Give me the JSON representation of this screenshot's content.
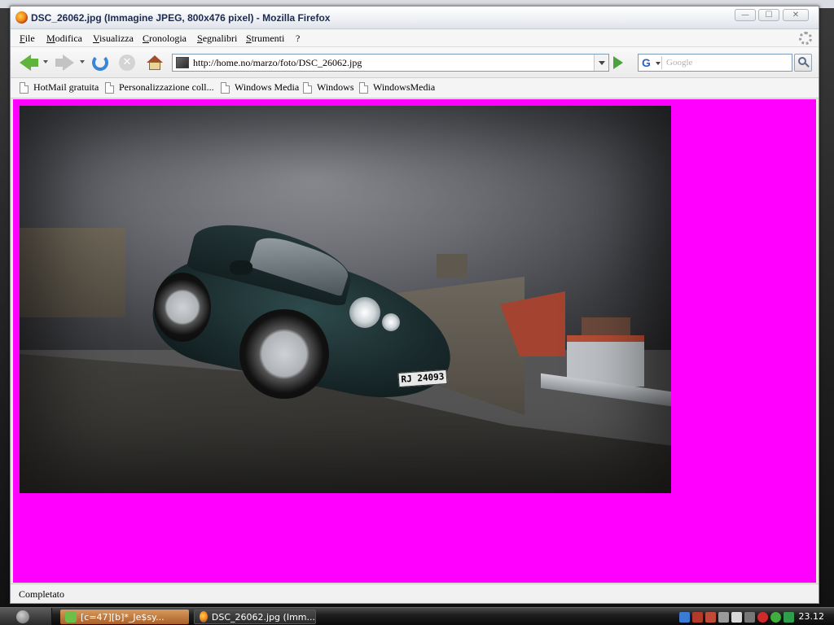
{
  "window": {
    "title": "DSC_26062.jpg (Immagine JPEG, 800x476 pixel) - Mozilla Firefox",
    "controls": {
      "minimize": "—",
      "maximize": "☐",
      "close": "✕"
    }
  },
  "menu": {
    "items": [
      "File",
      "Modifica",
      "Visualizza",
      "Cronologia",
      "Segnalibri",
      "Strumenti",
      "?"
    ]
  },
  "navigation": {
    "url": "http://home.no/marzo/foto/DSC_26062.jpg",
    "search_engine": "G",
    "search_placeholder": "Google"
  },
  "bookmarks": {
    "items": [
      "HotMail gratuita",
      "Personalizzazione coll...",
      "Windows Media",
      "Windows",
      "WindowsMedia"
    ]
  },
  "content": {
    "background_color": "#ff00ff",
    "image_alt": "DSC_26062.jpg",
    "plate_text": "RJ 24093"
  },
  "status": {
    "text": "Completato"
  },
  "taskbar": {
    "tasks": [
      "[c=47][b]*_Je$sy...",
      "DSC_26062.jpg (Imm..."
    ],
    "clock": "23.12"
  },
  "colors": {
    "accent_green": "#5fb53c",
    "reload_blue": "#3a86d6",
    "content_magenta": "#ff00ff"
  },
  "icons": [
    "firefox-icon",
    "back-icon",
    "forward-icon",
    "reload-icon",
    "stop-icon",
    "home-icon",
    "google-icon",
    "search-icon",
    "bookmark-page-icon",
    "throbber-icon",
    "go-icon"
  ]
}
